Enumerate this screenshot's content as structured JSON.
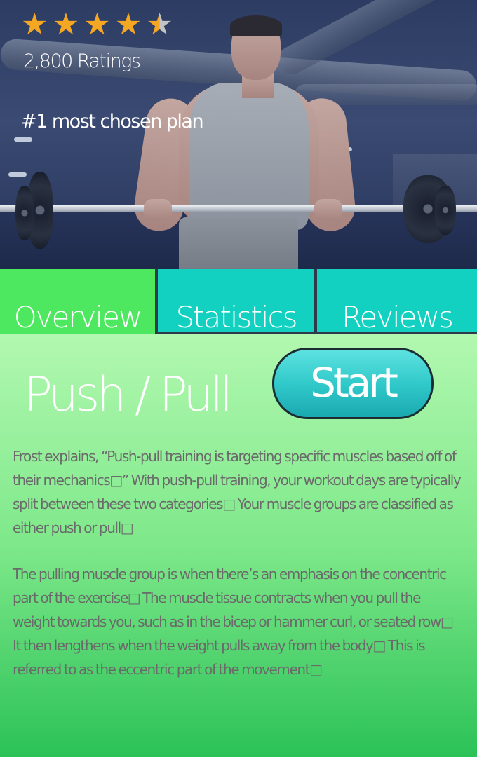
{
  "hero": {
    "rating": 4.5,
    "stars": [
      "full",
      "full",
      "full",
      "full",
      "half"
    ],
    "ratings_text": "2,800 Ratings",
    "badge_text": "#1 most chosen plan"
  },
  "tabs": [
    {
      "label": "Overview",
      "active": true
    },
    {
      "label": "Statistics",
      "active": false
    },
    {
      "label": "Reviews",
      "active": false
    }
  ],
  "plan": {
    "title": "Push / Pull",
    "start_label": "Start"
  },
  "description": {
    "p1": "Frost explains, “Push-pull training is targeting specific muscles based off of their mechanics□” With push-pull training, your workout days are typically split between these two categories□ Your muscle groups are classified as either push or pull□",
    "p2": "The pulling muscle group is when there’s an emphasis on the concentric part of the exercise□ The muscle tissue contracts when you pull the weight towards you, such as in the bicep or hammer curl, or seated row□ It then lengthens when the weight pulls away from the body□ This is referred to as the eccentric part of the movement□"
  },
  "colors": {
    "star": "#f5a623",
    "tab_active": "#4de85f",
    "tab_inactive": "#13d1c0",
    "start_button": "#2ec7c8",
    "body_text": "#6a6a6a"
  }
}
